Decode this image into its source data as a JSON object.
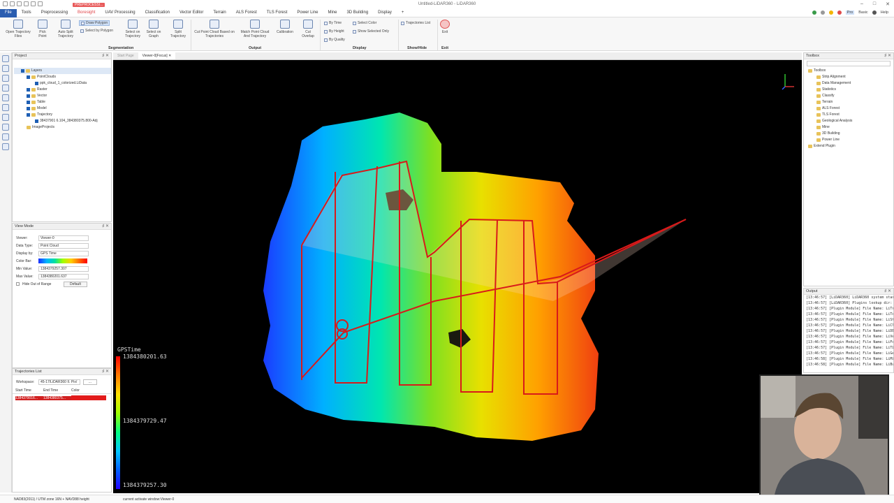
{
  "app": {
    "title": "Untitled-LiDAR360 - LiDAR360",
    "badge": "PREPROCESSI..."
  },
  "menu": [
    "File",
    "Tools",
    "Preprocessing",
    "Boresight",
    "UAV Processing",
    "Classification",
    "Vector Editor",
    "Terrain",
    "ALS Forest",
    "TLS Forest",
    "Power Line",
    "Mine",
    "3D Building",
    "Display",
    "+"
  ],
  "menu_right": {
    "pro": "Pro",
    "basic": "Basic",
    "help": "Help"
  },
  "ribbon": {
    "open_traj": "Open Trajectory Files",
    "pick_point": "Pick Point",
    "auto_split": "Auto Split Trajectory",
    "draw_polygon": "Draw Polygon",
    "select_polygon": "Select by Polygon",
    "select_traj": "Select on Trajectory",
    "select_graph": "Select on Graph",
    "split_traj": "Split Trajectory",
    "cut_pc": "Cut Point Cloud Based on Trajectories",
    "match_pc": "Match Point Cloud And Trajectory",
    "calibration": "Calibration",
    "cut_overlap": "Cut Overlap",
    "by_time": "By Time",
    "by_height": "By Height",
    "by_quality": "By Quality",
    "select_color": "Select Color",
    "show_selected": "Show Selected Only",
    "traj_list": "Trajectories List",
    "exit": "Exit",
    "g_segmentation": "Segmentation",
    "g_output": "Output",
    "g_display": "Display",
    "g_showhide": "Show/Hide",
    "g_exit": "Exit"
  },
  "project": {
    "title": "Project",
    "items": [
      "Layers",
      "PointClouds",
      "ppk_cloud_1_colorized.LiData",
      "Raster",
      "Vector",
      "Table",
      "Model",
      "Trajectory",
      "38437901 6.104_384380375.800-Adj",
      "ImageProjects"
    ]
  },
  "viewmode": {
    "title": "View Mode",
    "viewer_lbl": "Viewer:",
    "viewer": "Viewer-0",
    "datatype_lbl": "Data Type:",
    "datatype": "Point Cloud",
    "display_lbl": "Display by:",
    "display": "GPS Time",
    "colorbar_lbl": "Color Bar:",
    "min_lbl": "Min Value:",
    "min": "1384379257.307",
    "max_lbl": "Max Value:",
    "max": "1384380201.637",
    "hide": "Hide Out of Range",
    "default_btn": "Default"
  },
  "trajlist": {
    "title": "Trajectories List",
    "ws_lbl": "Workspace:",
    "ws": "45-17/LiDAR360 II. Pix/",
    "cols": [
      "Start Time",
      "End Time",
      "Color"
    ],
    "row": [
      "1384379016...",
      "1384380375..."
    ],
    "color": "#e21b1b"
  },
  "viewer": {
    "tabs": [
      "Start Page",
      "Viewer-0[Focus]"
    ],
    "legend_title": "GPSTime",
    "legend_max": "1384380201.63",
    "legend_mid": "1384379729.47",
    "legend_min": "1384379257.30"
  },
  "toolbox": {
    "title": "Toolbox",
    "items": [
      "Toolbox",
      "Strip Alignment",
      "Data Management",
      "Statistics",
      "Classify",
      "Terrain",
      "ALS Forest",
      "TLS Forest",
      "Geological Analysis",
      "Mine",
      "3D Building",
      "Power Line",
      "Extend Plugin"
    ]
  },
  "output": {
    "title": "Output",
    "lines": [
      "[13:46:57] [LiDAR360]    LiDAR360 system started",
      "[13:46:57] [LiDAR360]    Plugins lookup dir: C:/Pro",
      "[13:46:57] [Plugin Module]   File Name: LiTraject",
      "[13:46:57] [Plugin Module]   File Name: LiTools.dl",
      "[13:46:57] [Plugin Module]   File Name: LiStatistic",
      "[13:46:57] [Plugin Module]   File Name: LiClassific",
      "[13:46:57] [Plugin Module]   File Name: LiDEM.dll",
      "[13:46:57] [Plugin Module]   File Name: LiVectorE",
      "[13:46:57] [Plugin Module]   File Name: LiForest.d",
      "[13:46:57] [Plugin Module]   File Name: LiTLSFore",
      "[13:46:57] [Plugin Module]   File Name: LiGeologi",
      "[13:46:58] [Plugin Module]   File Name: LiMine.dll",
      "[13:46:58] [Plugin Module]   File Name: LiBuilding"
    ]
  },
  "status": {
    "crs": "NAD83(2011) / UTM zone 16N + NAVD88 height",
    "active": "current activate window:Viewer-0"
  }
}
